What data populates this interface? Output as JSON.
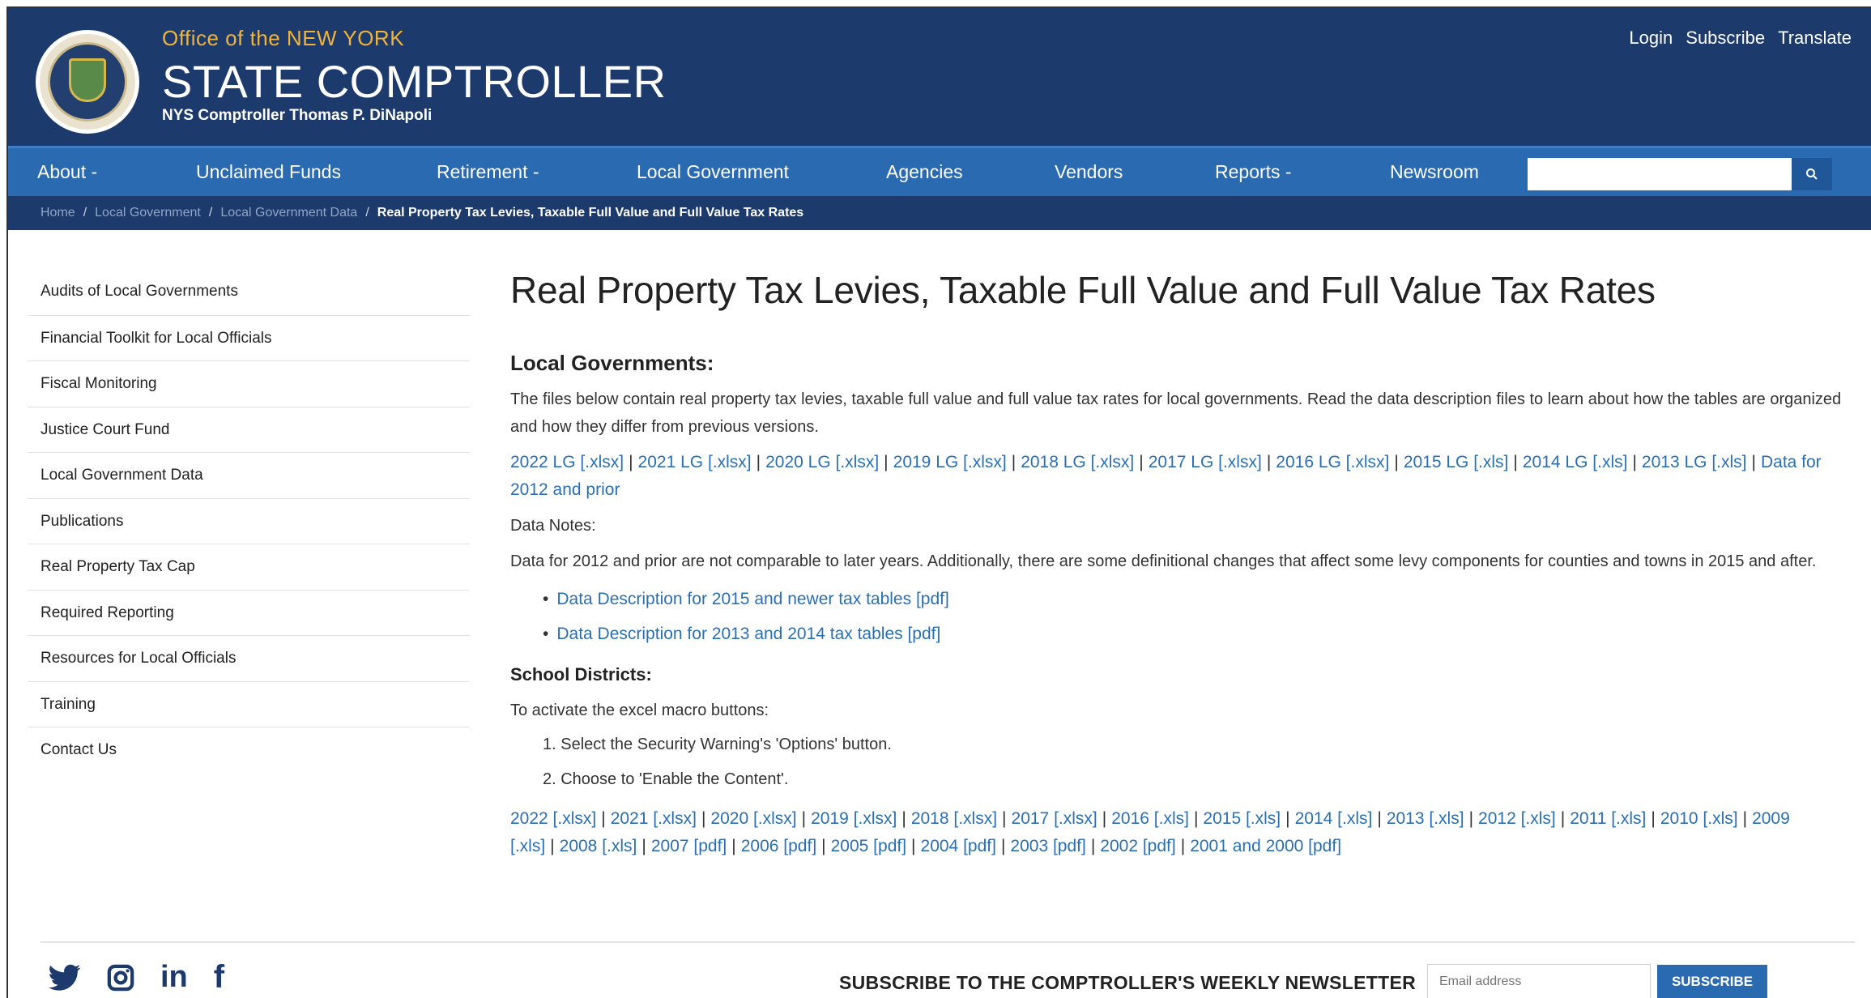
{
  "header": {
    "office_line": "Office of the NEW YORK",
    "title": "STATE COMPTROLLER",
    "subtitle": "NYS Comptroller Thomas P. DiNapoli",
    "utility_links": [
      "Login",
      "Subscribe",
      "Translate"
    ]
  },
  "nav": {
    "items": [
      "About -",
      "Unclaimed Funds",
      "Retirement -",
      "Local Government",
      "Agencies",
      "Vendors",
      "Reports -",
      "Newsroom"
    ],
    "search_placeholder": ""
  },
  "breadcrumb": {
    "items": [
      "Home",
      "Local Government",
      "Local Government Data"
    ],
    "current": "Real Property Tax Levies, Taxable Full Value and Full Value Tax Rates"
  },
  "sidebar": {
    "items": [
      "Audits of Local Governments",
      "Financial Toolkit for Local Officials",
      "Fiscal Monitoring",
      "Justice Court Fund",
      "Local Government Data",
      "Publications",
      "Real Property Tax Cap",
      "Required Reporting",
      "Resources for Local Officials",
      "Training",
      "Contact Us"
    ]
  },
  "main": {
    "title": "Real Property Tax Levies, Taxable Full Value and Full Value Tax Rates",
    "local_heading": "Local Governments:",
    "local_intro": "The files below contain real property tax levies, taxable full value and full value tax rates for local governments. Read the data description files to learn about how the tables are organized and how they differ from previous versions.",
    "local_links": [
      "2022 LG [.xlsx]",
      "2021 LG [.xlsx]",
      "2020 LG [.xlsx]",
      "2019 LG [.xlsx]",
      "2018 LG [.xlsx]",
      "2017 LG [.xlsx]",
      "2016 LG [.xlsx]",
      "2015 LG [.xls]",
      "2014 LG [.xls]",
      "2013 LG [.xls]",
      "Data for 2012 and prior"
    ],
    "data_notes_label": "Data Notes:",
    "data_notes_text": "Data for 2012 and prior are not comparable to later years. Additionally, there are some definitional changes that affect some levy components for counties and towns in 2015 and after.",
    "description_links": [
      "Data Description for 2015 and newer tax tables [pdf]",
      "Data Description for 2013 and 2014 tax tables [pdf]"
    ],
    "school_heading": "School Districts:",
    "macro_intro": "To activate the excel macro buttons:",
    "macro_steps": [
      "1. Select the Security Warning's 'Options' button.",
      "2. Choose to 'Enable the Content'."
    ],
    "school_links": [
      "2022 [.xlsx]",
      "2021 [.xlsx]",
      "2020 [.xlsx]",
      "2019 [.xlsx]",
      "2018 [.xlsx]",
      "2017 [.xlsx]",
      "2016 [.xls]",
      "2015 [.xls]",
      "2014 [.xls]",
      "2013 [.xls]",
      "2012 [.xls]",
      "2011 [.xls]",
      "2010 [.xls]",
      "2009 [.xls]",
      "2008 [.xls]",
      "2007 [pdf]",
      "2006 [pdf]",
      "2005 [pdf]",
      "2004 [pdf]",
      "2003 [pdf]",
      "2002 [pdf]",
      "2001 and 2000 [pdf]"
    ]
  },
  "footer": {
    "social_icons": [
      "twitter-icon",
      "instagram-icon",
      "linkedin-icon",
      "facebook-icon"
    ],
    "linkedin_glyph": "in",
    "facebook_glyph": "f",
    "newsletter_label": "SUBSCRIBE TO THE COMPTROLLER'S WEEKLY NEWSLETTER",
    "email_placeholder": "Email address",
    "subscribe_label": "SUBSCRIBE"
  },
  "colors": {
    "header_bg": "#1c3a6b",
    "nav_bg": "#2a6ab0",
    "accent_gold": "#f0b43a",
    "link": "#2a6fb5"
  }
}
